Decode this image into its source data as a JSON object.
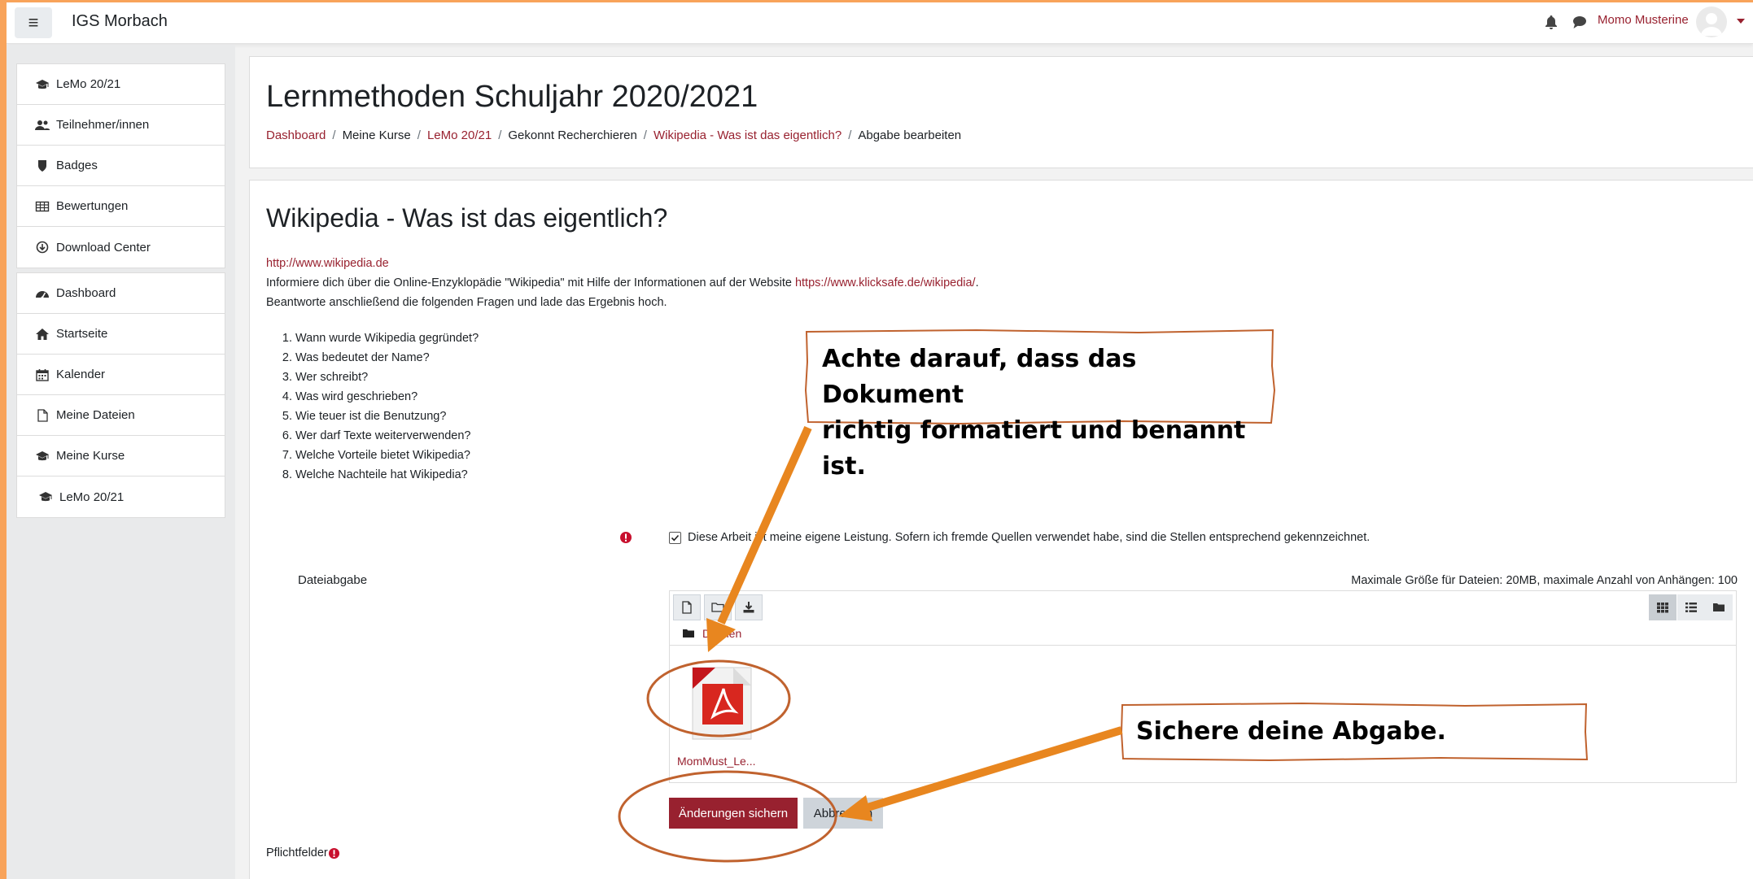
{
  "navbar": {
    "menu_icon": "hamburger-icon",
    "site_name": "IGS Morbach",
    "user_name": "Momo Musterine"
  },
  "sidebar": {
    "course_block": [
      {
        "label": "LeMo 20/21",
        "icon": "graduation-cap-icon"
      },
      {
        "label": "Teilnehmer/innen",
        "icon": "users-icon"
      },
      {
        "label": "Badges",
        "icon": "shield-icon"
      },
      {
        "label": "Bewertungen",
        "icon": "table-icon"
      },
      {
        "label": "Download Center",
        "icon": "download-circle-icon"
      }
    ],
    "main_block": [
      {
        "label": "Dashboard",
        "icon": "dashboard-icon"
      },
      {
        "label": "Startseite",
        "icon": "home-icon"
      },
      {
        "label": "Kalender",
        "icon": "calendar-icon"
      },
      {
        "label": "Meine Dateien",
        "icon": "file-icon"
      },
      {
        "label": "Meine Kurse",
        "icon": "graduation-cap-icon"
      },
      {
        "label": "LeMo 20/21",
        "icon": "graduation-cap-icon"
      }
    ]
  },
  "header": {
    "course_title": "Lernmethoden Schuljahr 2020/2021",
    "breadcrumb": [
      "Dashboard",
      "Meine Kurse",
      "LeMo 20/21",
      "Gekonnt Recherchieren",
      "Wikipedia - Was ist das eigentlich?",
      "Abgabe bearbeiten"
    ]
  },
  "activity": {
    "title": "Wikipedia - Was ist das eigentlich?",
    "link": "http://www.wikipedia.de",
    "intro_before": "Informiere dich über die Online-Enzyklopädie \"Wikipedia\" mit Hilfe der Informationen auf der Website ",
    "intro_link": "https://www.klicksafe.de/wikipedia/",
    "intro_after": ".",
    "intro_line2": "Beantworte anschließend die folgenden Fragen und lade das Ergebnis hoch.",
    "questions": [
      "Wann wurde Wikipedia gegründet?",
      "Was bedeutet der Name?",
      "Wer schreibt?",
      "Was wird geschrieben?",
      "Wie teuer ist die Benutzung?",
      "Wer darf Texte weiterverwenden?",
      "Welche Vorteile bietet Wikipedia?",
      "Welche Nachteile hat Wikipedia?"
    ]
  },
  "form": {
    "declaration": "Diese Arbeit ist meine eigene Leistung. Sofern ich fremde Quellen verwendet habe, sind die Stellen entsprechend gekennzeichnet.",
    "declaration_checked": true,
    "file_label": "Dateiabgabe",
    "file_limits": "Maximale Größe für Dateien: 20MB, maximale Anzahl von Anhängen: 100",
    "folder_name": "Dateien",
    "file_name": "MomMust_Le...",
    "save_label": "Änderungen sichern",
    "cancel_label": "Abbrechen",
    "required_label": "Pflichtfelder"
  },
  "annotations": {
    "callout_top_line1": "Achte darauf, dass das Dokument",
    "callout_top_line2": "richtig formatiert und benannt ist.",
    "callout_bottom": "Sichere deine Abgabe.",
    "arrow_color": "#e8861f",
    "ellipse_color": "#c0622e"
  },
  "colors": {
    "accent": "#98212f",
    "frame_border": "#f8a35a"
  }
}
